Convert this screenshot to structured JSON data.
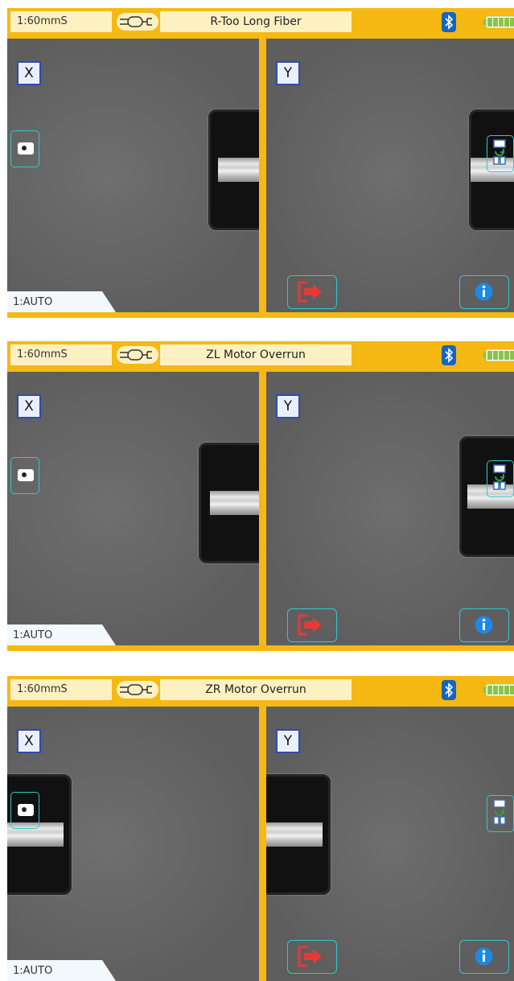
{
  "screens": [
    {
      "program": "1:60mmS",
      "title": "R-Too Long Fiber",
      "left_axis": "X",
      "right_axis": "Y",
      "auto_mode": "1:AUTO"
    },
    {
      "program": "1:60mmS",
      "title": "ZL Motor Overrun",
      "left_axis": "X",
      "right_axis": "Y",
      "auto_mode": "1:AUTO"
    },
    {
      "program": "1:60mmS",
      "title": "ZR Motor Overrun",
      "left_axis": "X",
      "right_axis": "Y",
      "auto_mode": "1:AUTO"
    }
  ],
  "icons": {
    "fiber": "fiber-cable-icon",
    "bluetooth": "bluetooth-icon",
    "battery": "battery-full-icon",
    "camera": "camera-icon",
    "swap": "screen-swap-icon",
    "exit": "exit-icon",
    "info": "info-icon"
  },
  "colors": {
    "frame": "#f6b913",
    "label_bg": "#fdf1c2",
    "button_border": "#32c9c9",
    "exit": "#e53935",
    "info": "#1e88e5",
    "bluetooth": "#1565c0",
    "battery": "#8bc34a"
  }
}
